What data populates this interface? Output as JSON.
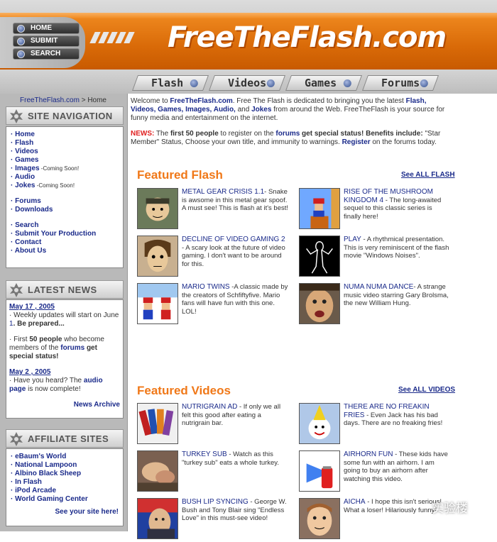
{
  "header": {
    "logo": "FreeTheFlash.com",
    "nav_buttons": [
      "HOME",
      "SUBMIT",
      "SEARCH"
    ],
    "tabs": [
      "Flash",
      "Videos",
      "Games",
      "Forums"
    ]
  },
  "sidebar": {
    "breadcrumb_site": "FreeTheFlash.com",
    "breadcrumb_rest": " > Home",
    "navigation": {
      "title": "SITE NAVIGATION",
      "group1": [
        {
          "label": "Home",
          "note": ""
        },
        {
          "label": "Flash",
          "note": ""
        },
        {
          "label": "Videos",
          "note": ""
        },
        {
          "label": "Games",
          "note": ""
        },
        {
          "label": "Images",
          "note": " -Coming Soon!"
        },
        {
          "label": "Audio",
          "note": ""
        },
        {
          "label": "Jokes",
          "note": " -Coming Soon!"
        }
      ],
      "group2": [
        "Forums",
        "Downloads"
      ],
      "group3": [
        "Search",
        "Submit Your Production",
        "Contact",
        "About Us"
      ]
    },
    "news": {
      "title": "LATEST NEWS",
      "date1": "May 17 , 2005",
      "item1a_pre": "· Weekly updates will start on June ",
      "item1a_link": "1",
      "item1a_post": ". Be prepared...",
      "item1b_pre": "· First ",
      "item1b_bold": "50 people",
      "item1b_mid": " who become members of the ",
      "item1b_link": "forums",
      "item1b_post": " get special status!",
      "date2": "May 2 , 2005",
      "item2_pre": "· Have you heard? The ",
      "item2_link": "audio page",
      "item2_post": " is now complete!",
      "archive": "News Archive"
    },
    "affiliates": {
      "title": "AFFILIATE SITES",
      "items": [
        "eBaum's World",
        "National Lampoon",
        "Albino Black Sheep",
        "In Flash",
        "iPod Arcade",
        "World Gaming Center"
      ],
      "cta": "See your site here!"
    }
  },
  "main": {
    "intro_pre": "Welcome to ",
    "intro_site": "FreeTheFlash.com",
    "intro_mid": ". Free The Flash is dedicated to bringing you the latest ",
    "intro_cats": "Flash, Videos, Games, Images, Audio,",
    "intro_and": " and ",
    "intro_jokes": "Jokes",
    "intro_post": " from around the Web. FreeTheFlash is your source for funny media and entertainment on the internet.",
    "news_label": "NEWS:",
    "news_pre": " The ",
    "news_bold1": "first 50 people",
    "news_mid1": " to register on the ",
    "news_link1": "forums",
    "news_mid2": " get special status! ",
    "news_bold2": "Benefits include:",
    "news_mid3": " \"Star Member\" Status, Choose your own title, and immunity to warnings. ",
    "news_link2": "Register",
    "news_post": " on the forums today.",
    "featured_flash": {
      "title": "Featured Flash",
      "see_all": "See ALL FLASH",
      "items": [
        {
          "title": "METAL GEAR CRISIS 1.1",
          "desc": "- Snake is awsome in this metal gear spoof. A must see! This is flash at it's best!"
        },
        {
          "title": "RISE OF THE MUSHROOM KINGDOM 4",
          "desc": " - The long-awaited sequel to this classic series is finally here!"
        },
        {
          "title": "DECLINE OF VIDEO GAMING 2",
          "desc": " - A scary look at the future of video gaming. I don't want to be around for this."
        },
        {
          "title": "PLAY",
          "desc": " - A rhythmical presentation. This is very reminiscent of the flash movie \"Windows Noises\"."
        },
        {
          "title": "MARIO TWINS",
          "desc": " -A classic made by the creators of Schfiftyfive. Mario fans will have fun with this one. LOL!"
        },
        {
          "title": "NUMA NUMA DANCE",
          "desc": "- A strange music video starring Gary Brolsma, the new William Hung."
        }
      ]
    },
    "featured_videos": {
      "title": "Featured Videos",
      "see_all": "See ALL VIDEOS",
      "items": [
        {
          "title": "NUTRIGRAIN AD",
          "desc": " - If only we all felt this good after eating a nutrigrain bar."
        },
        {
          "title": "THERE ARE NO FREAKIN FRIES",
          "desc": " - Even Jack has his bad days. There are no freaking fries!"
        },
        {
          "title": "TURKEY SUB",
          "desc": " - Watch as this \"turkey sub\" eats a whole turkey."
        },
        {
          "title": "AIRHORN FUN",
          "desc": " - These kids have some fun with an airhorn. I am going to buy an airhorn after watching this video."
        },
        {
          "title": "BUSH LIP SYNCING",
          "desc": " - George W. Bush and Tony Blair sing \"Endless Love\" in this must-see video!"
        },
        {
          "title": "AICHA",
          "desc": " - I hope this isn't serious! What a loser! Hilariously funny!"
        }
      ]
    }
  },
  "watermark": "实验楼",
  "colors": {
    "accent_orange": "#f07818",
    "header_orange": "#d96a08",
    "link_blue": "#1a2a8a",
    "sidebar_grey": "#b9b9b9"
  }
}
